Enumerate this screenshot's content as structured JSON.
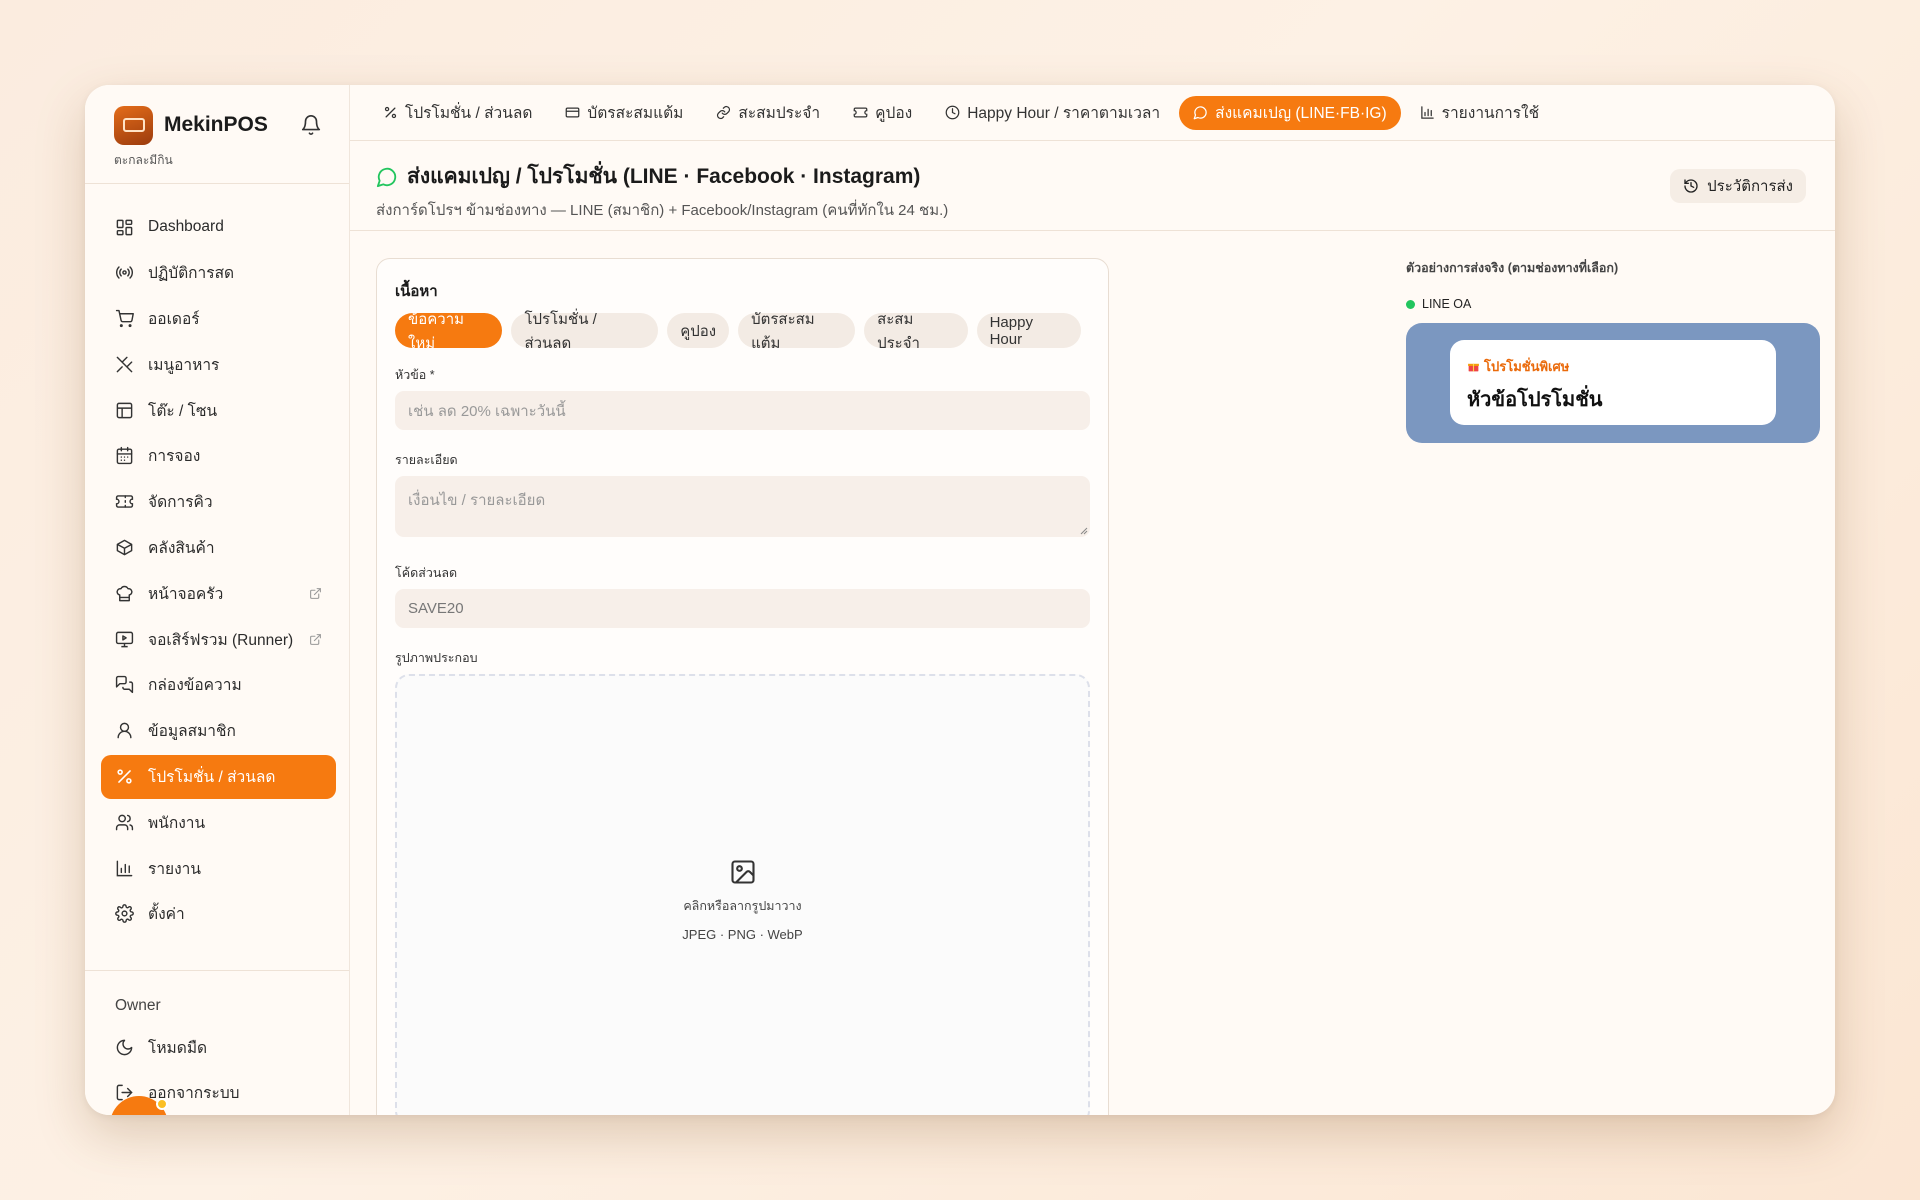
{
  "brand": {
    "name": "MekinPOS",
    "subtitle": "ตะกละมีกิน"
  },
  "sidebar": {
    "items": [
      {
        "label": "Dashboard"
      },
      {
        "label": "ปฏิบัติการสด"
      },
      {
        "label": "ออเดอร์"
      },
      {
        "label": "เมนูอาหาร"
      },
      {
        "label": "โต๊ะ / โซน"
      },
      {
        "label": "การจอง"
      },
      {
        "label": "จัดการคิว"
      },
      {
        "label": "คลังสินค้า"
      },
      {
        "label": "หน้าจอครัว"
      },
      {
        "label": "จอเสิร์ฟรวม (Runner)"
      },
      {
        "label": "กล่องข้อความ"
      },
      {
        "label": "ข้อมูลสมาชิก"
      },
      {
        "label": "โปรโมชั่น / ส่วนลด"
      },
      {
        "label": "พนักงาน"
      },
      {
        "label": "รายงาน"
      },
      {
        "label": "ตั้งค่า"
      }
    ],
    "owner_label": "Owner",
    "dark_mode": "โหมดมืด",
    "logout": "ออกจากระบบ"
  },
  "tabs": [
    {
      "label": "โปรโมชั่น / ส่วนลด"
    },
    {
      "label": "บัตรสะสมแต้ม"
    },
    {
      "label": "สะสมประจำ"
    },
    {
      "label": "คูปอง"
    },
    {
      "label": "Happy Hour / ราคาตามเวลา"
    },
    {
      "label": "ส่งแคมเปญ (LINE·FB·IG)"
    },
    {
      "label": "รายงานการใช้"
    }
  ],
  "page": {
    "title": "ส่งแคมเปญ / โปรโมชั่น (LINE · Facebook · Instagram)",
    "subtitle": "ส่งการ์ดโปรฯ ข้ามช่องทาง — LINE (สมาชิก) + Facebook/Instagram (คนที่ทักใน 24 ชม.)",
    "history_button": "ประวัติการส่ง"
  },
  "form": {
    "section_title": "เนื้อหา",
    "chips": [
      "ข้อความใหม่",
      "โปรโมชั่น / ส่วนลด",
      "คูปอง",
      "บัตรสะสมแต้ม",
      "สะสมประจำ",
      "Happy Hour"
    ],
    "title_label": "หัวข้อ *",
    "title_placeholder": "เช่น ลด 20% เฉพาะวันนี้",
    "detail_label": "รายละเอียด",
    "detail_placeholder": "เงื่อนไข / รายละเอียด",
    "code_label": "โค้ดส่วนลด",
    "code_value": "SAVE20",
    "image_label": "รูปภาพประกอบ",
    "drop_text": "คลิกหรือลากรูปมาวาง",
    "drop_formats": "JPEG · PNG · WebP"
  },
  "preview": {
    "title": "ตัวอย่างการส่งจริง (ตามช่องทางที่เลือก)",
    "channel": "LINE OA",
    "tag": "โปรโมชั่นพิเศษ",
    "headline": "หัวข้อโปรโมชั่น"
  },
  "colors": {
    "accent": "#f67a10",
    "line_bg": "#7b97c0",
    "online": "#22c55e"
  }
}
